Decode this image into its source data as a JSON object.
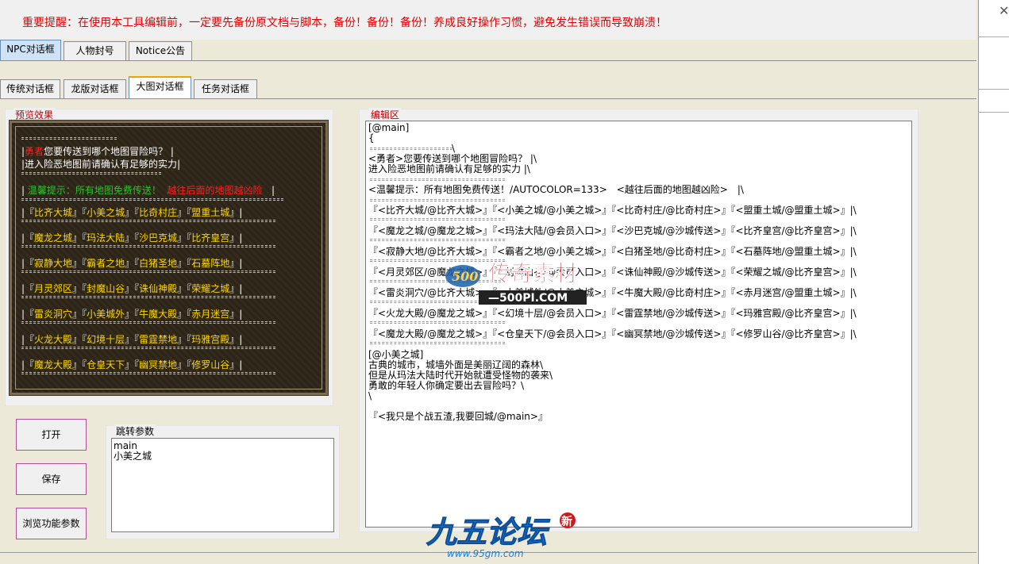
{
  "warning": "重要提醒：在使用本工具编辑前，一定要先备份原文档与脚本，备份！备份！备份！养成良好操作习惯，避免发生错误而导致崩溃！",
  "top_tabs": [
    "NPC对话框",
    "人物封号",
    "Notice公告"
  ],
  "sub_tabs": [
    "传统对话框",
    "龙版对话框",
    "大图对话框",
    "任务对话框"
  ],
  "preview": {
    "title": "预览效果",
    "hero": "勇者",
    "line1": "您要传送到哪个地图冒险吗？",
    "line2": "进入险恶地图前请确认有足够的实力",
    "tip_green": "温馨提示：所有地图免费传送！",
    "tip_red": "越往后面的地图越凶险",
    "rows": [
      [
        "比齐大城",
        "小美之城",
        "比奇村庄",
        "盟重土城"
      ],
      [
        "魔龙之城",
        "玛法大陆",
        "沙巴克城",
        "比齐皇宫"
      ],
      [
        "寂静大地",
        "霸者之地",
        "白猪圣地",
        "石墓阵地"
      ],
      [
        "月灵郊区",
        "封魔山谷",
        "诛仙神殿",
        "荣耀之城"
      ],
      [
        "雷炎洞穴",
        "小美城外",
        "牛魔大殿",
        "赤月迷宫"
      ],
      [
        "火龙大殿",
        "幻境十层",
        "雷霆禁地",
        "玛雅宫殿"
      ],
      [
        "魔龙大殿",
        "仓皇天下",
        "幽冥禁地",
        "修罗山谷"
      ]
    ]
  },
  "buttons": {
    "open": "打开",
    "save": "保存",
    "browse": "浏览功能参数"
  },
  "params": {
    "title": "跳转参数",
    "lines": [
      "main",
      "小美之城"
    ]
  },
  "editor": {
    "title": "编辑区",
    "head": [
      "[@main]",
      "{"
    ],
    "intro": [
      "<勇者>您要传送到哪个地图冒险吗？ |\\",
      "进入险恶地图前请确认有足够的实力 |\\"
    ],
    "tip": "<温馨提示：所有地图免费传送！/AUTOCOLOR=133>　<越往后面的地图越凶险>　|\\",
    "rows": [
      "『<比齐大城/@比齐大城>』『<小美之城/@小美之城>』『<比奇村庄/@比奇村庄>』『<盟重土城/@盟重土城>』|\\",
      "『<魔龙之城/@魔龙之城>』『<玛法大陆/@会员入口>』『<沙巴克城/@沙城传送>』『<比齐皇宫/@比齐皇宫>』|\\",
      "『<寂静大地/@比齐大城>』『<霸者之地/@小美之城>』『<白猪圣地/@比奇村庄>』『<石墓阵地/@盟重土城>』|\\",
      "『<月灵郊区/@魔龙之城>』『<封魔山谷/@会员入口>』『<诛仙神殿/@沙城传送>』『<荣耀之城/@比齐皇宫>』|\\",
      "『<雷炎洞穴/@比齐大城>』『<小美城外/@小美之城>』『<牛魔大殿/@比奇村庄>』『<赤月迷宫/@盟重土城>』|\\",
      "『<火龙大殿/@魔龙之城>』『<幻境十层/@会员入口>』『<雷霆禁地/@沙城传送>』『<玛雅宫殿/@比齐皇宫>』|\\",
      "『<魔龙大殿/@魔龙之城>』『<仓皇天下/@会员入口>』『<幽冥禁地/@沙城传送>』『<修罗山谷/@比齐皇宫>』|\\"
    ],
    "tail": [
      "[@小美之城]",
      "古典的城市，城墙外面是美丽辽阔的森林\\",
      "但是从玛法大陆时代开始就遭受怪物的袭来\\",
      "勇敢的年轻人你确定要出去冒险吗？\\",
      "\\",
      "『<我只是个战五渣,我要回城/@main>』"
    ]
  },
  "watermark": {
    "brand": "传奇素材",
    "url": "500PI.COM"
  },
  "footer_logo": {
    "brand": "九五论坛",
    "url": "www.95gm.com",
    "badge": "新"
  },
  "colors": {
    "warning": "#e00000",
    "group_title": "#c00000",
    "preview_gold": "#ffd700",
    "preview_green": "#2ec22e",
    "preview_red": "#ff2020"
  }
}
